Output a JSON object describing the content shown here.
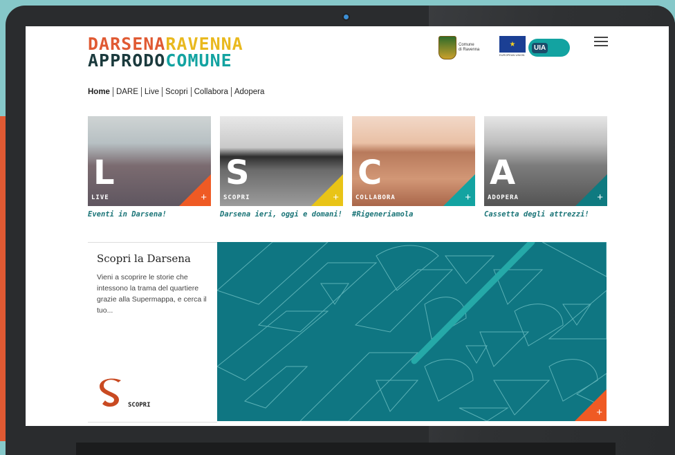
{
  "logo": {
    "line1_part1": "DARSENA",
    "line1_part2": "RAVENNA",
    "line2_part1": "APPRODO",
    "line2_part2": "COMUNE"
  },
  "partners": {
    "ravenna_text1": "Comune",
    "ravenna_text2": "di Ravenna",
    "eu_text": "EUROPEAN UNION",
    "uia_text": "UIA"
  },
  "nav": {
    "items": [
      "Home",
      "DARE",
      "Live",
      "Scopri",
      "Collabora",
      "Adopera"
    ]
  },
  "tiles": [
    {
      "letter": "L",
      "label": "LIVE",
      "caption": "Eventi in Darsena!",
      "color": "#ef5a24"
    },
    {
      "letter": "S",
      "label": "SCOPRI",
      "caption": "Darsena ieri, oggi e domani!",
      "color": "#e9c416"
    },
    {
      "letter": "C",
      "label": "COLLABORA",
      "caption": "#Rigeneriamola",
      "color": "#13a3a1"
    },
    {
      "letter": "A",
      "label": "ADOPERA",
      "caption": "Cassetta degli attrezzi!",
      "color": "#0f7a80"
    }
  ],
  "feature": {
    "title": "Scopri la Darsena",
    "text": "Vieni a scoprire le storie che intessono la trama del quartiere grazie alla Supermappa, e cerca il tuo...",
    "badge_label": "SCOPRI",
    "accent": "#0f7682"
  },
  "icons": {
    "menu": "hamburger-icon",
    "plus": "plus-icon"
  }
}
